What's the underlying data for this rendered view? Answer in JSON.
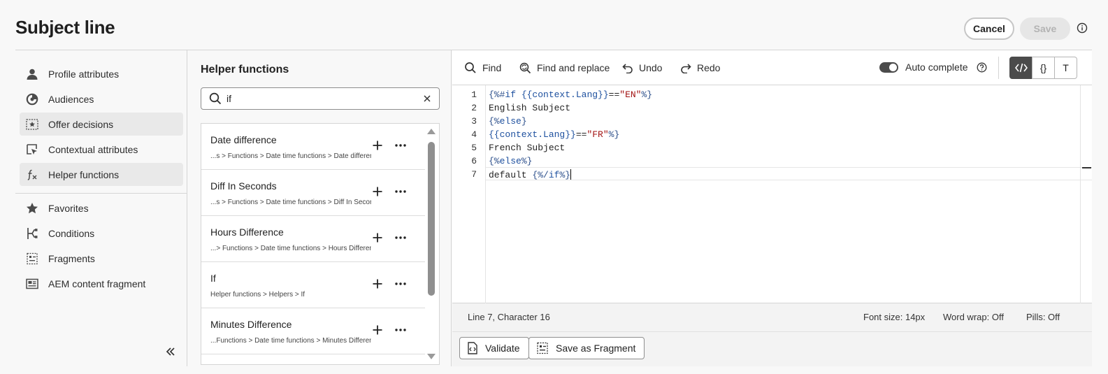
{
  "header": {
    "title": "Subject line",
    "cancel_label": "Cancel",
    "save_label": "Save"
  },
  "nav": {
    "items": [
      {
        "label": "Profile attributes",
        "icon": "user-icon"
      },
      {
        "label": "Audiences",
        "icon": "audiences-icon"
      },
      {
        "label": "Offer decisions",
        "icon": "offer-decisions-icon"
      },
      {
        "label": "Contextual attributes",
        "icon": "contextual-attributes-icon"
      },
      {
        "label": "Helper functions",
        "icon": "function-icon",
        "active": true
      },
      {
        "label": "Favorites",
        "icon": "star-icon"
      },
      {
        "label": "Conditions",
        "icon": "conditions-icon"
      },
      {
        "label": "Fragments",
        "icon": "fragments-icon"
      },
      {
        "label": "AEM content fragment",
        "icon": "aem-fragment-icon"
      }
    ]
  },
  "helper": {
    "title": "Helper functions",
    "search_value": "if",
    "items": [
      {
        "name": "Date difference",
        "path": "...s > Functions > Date time functions > Date difference"
      },
      {
        "name": "Diff In Seconds",
        "path": "...s > Functions > Date time functions > Diff In Seconds"
      },
      {
        "name": "Hours Difference",
        "path": "...> Functions > Date time functions > Hours Difference"
      },
      {
        "name": "If",
        "path": "Helper functions > Helpers > If"
      },
      {
        "name": "Minutes Difference",
        "path": "...Functions > Date time functions > Minutes Difference"
      }
    ]
  },
  "toolbar": {
    "find": "Find",
    "find_replace": "Find and replace",
    "undo": "Undo",
    "redo": "Redo",
    "auto_complete": "Auto complete",
    "auto_complete_on": true,
    "braces_label": "{}",
    "text_label": "T"
  },
  "editor": {
    "line_numbers": [
      "1",
      "2",
      "3",
      "4",
      "5",
      "6",
      "7"
    ],
    "lines": [
      "{%#if {{context.Lang}}==\"EN\"%}",
      "English Subject",
      "{%else}",
      "{{context.Lang}}==\"FR\"%}",
      "French Subject",
      "{%else%}",
      "default {%/if%}"
    ]
  },
  "status": {
    "position": "Line 7, Character 16",
    "font_size": "Font size: 14px",
    "word_wrap": "Word wrap: Off",
    "pills": "Pills: Off"
  },
  "actions": {
    "validate": "Validate",
    "save_fragment": "Save as Fragment"
  },
  "colors": {
    "accent_dark": "#4b4b4b",
    "keyword": "#1c4f9e",
    "string": "#a31515"
  }
}
